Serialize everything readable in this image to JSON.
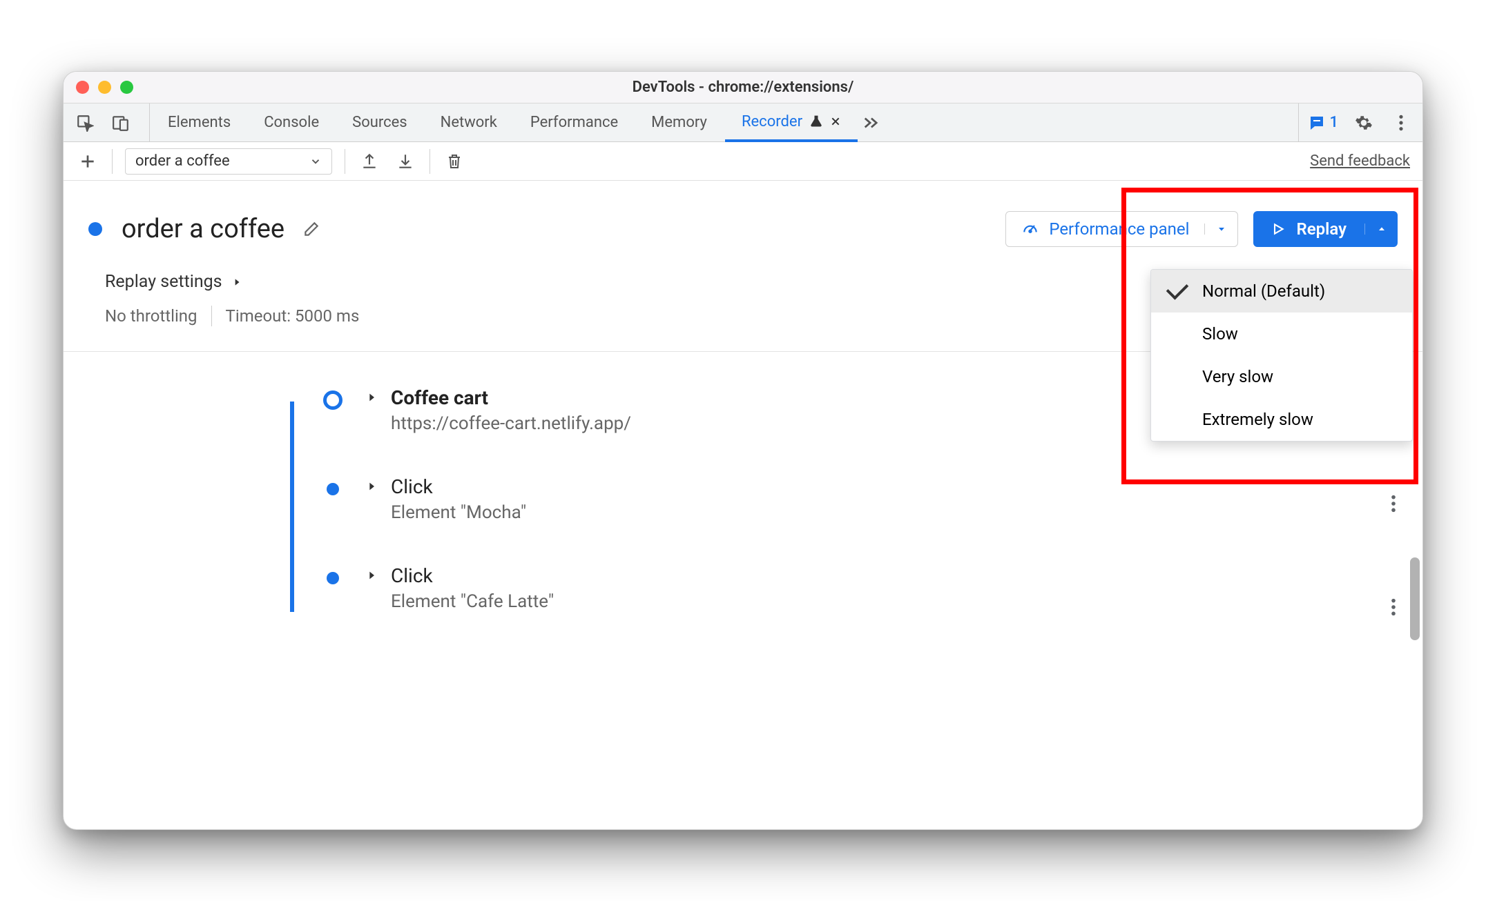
{
  "window": {
    "title": "DevTools - chrome://extensions/"
  },
  "tabs": {
    "items": [
      "Elements",
      "Console",
      "Sources",
      "Network",
      "Performance",
      "Memory"
    ],
    "active": {
      "label": "Recorder"
    },
    "issues_count": "1"
  },
  "toolbar": {
    "recording_name": "order a coffee",
    "feedback_label": "Send feedback"
  },
  "recording": {
    "title": "order a coffee",
    "perf_button": "Performance panel",
    "replay_button": "Replay"
  },
  "replay_menu": {
    "options": [
      "Normal (Default)",
      "Slow",
      "Very slow",
      "Extremely slow"
    ],
    "selected_index": 0
  },
  "settings": {
    "header": "Replay settings",
    "throttling": "No throttling",
    "timeout": "Timeout: 5000 ms"
  },
  "steps": [
    {
      "title": "Coffee cart",
      "subtitle": "https://coffee-cart.netlify.app/",
      "bold": true,
      "marker": "open"
    },
    {
      "title": "Click",
      "subtitle": "Element \"Mocha\"",
      "bold": false,
      "marker": "fill"
    },
    {
      "title": "Click",
      "subtitle": "Element \"Cafe Latte\"",
      "bold": false,
      "marker": "fill"
    }
  ]
}
